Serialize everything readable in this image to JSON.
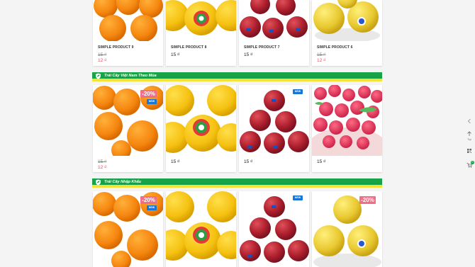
{
  "sections": [
    {
      "title": "",
      "products": [
        {
          "name": "SIMPLE PRODUCT 9",
          "old_price": "15 ₫",
          "price": "12 ₫",
          "image": "oranges"
        },
        {
          "name": "SIMPLE PRODUCT 8",
          "price": "15 ₫",
          "image": "grapefruit"
        },
        {
          "name": "SIMPLE PRODUCT 7",
          "price": "15 ₫",
          "image": "apples"
        },
        {
          "name": "SIMPLE PRODUCT 6",
          "old_price": "15 ₫",
          "price": "12 ₫",
          "image": "pears"
        }
      ]
    },
    {
      "title": "Trái Cây Việt Nam Theo Mùa",
      "products": [
        {
          "badge_sale": "-20%",
          "badge_new": "NEW",
          "old_price": "15 ₫",
          "price": "12 ₫",
          "image": "oranges"
        },
        {
          "price": "15 ₫",
          "image": "grapefruit"
        },
        {
          "badge_new": "NEW",
          "price": "15 ₫",
          "image": "apples"
        },
        {
          "price": "15 ₫",
          "image": "raspberries"
        }
      ]
    },
    {
      "title": "Trái Cây Nhập Khẩu",
      "products": [
        {
          "badge_sale": "-20%",
          "badge_new": "NEW",
          "image": "oranges"
        },
        {
          "image": "grapefruit"
        },
        {
          "badge_new": "NEW",
          "image": "apples"
        },
        {
          "badge_sale": "-20%",
          "image": "pears"
        }
      ]
    }
  ],
  "side_rail": {
    "back_label": "Top",
    "cart_count": "0"
  }
}
